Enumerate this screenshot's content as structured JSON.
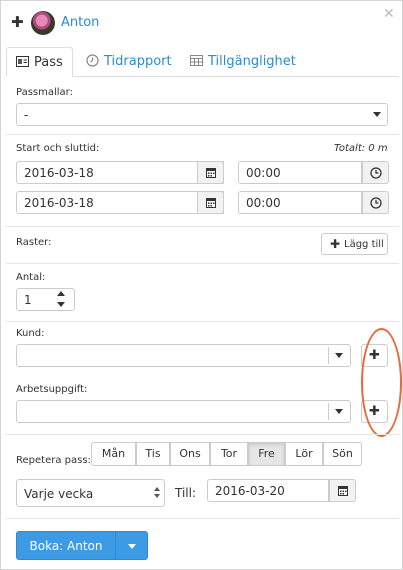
{
  "header": {
    "user_name": "Anton"
  },
  "tabs": [
    {
      "label": "Pass",
      "icon": "id-card-icon",
      "active": true
    },
    {
      "label": "Tidrapport",
      "icon": "clock-icon",
      "active": false
    },
    {
      "label": "Tillgänglighet",
      "icon": "calendar-icon",
      "active": false
    }
  ],
  "passmallar": {
    "label": "Passmallar:",
    "value": "-"
  },
  "time": {
    "label": "Start och sluttid:",
    "total": "Totalt: 0 m",
    "start_date": "2016-03-18",
    "start_time": "00:00",
    "end_date": "2016-03-18",
    "end_time": "00:00"
  },
  "raster": {
    "label": "Raster:",
    "add_label": "Lägg till"
  },
  "antal": {
    "label": "Antal:",
    "value": "1"
  },
  "kund": {
    "label": "Kund:",
    "value": ""
  },
  "arbetsuppgift": {
    "label": "Arbetsuppgift:",
    "value": ""
  },
  "repeat": {
    "label": "Repetera pass:",
    "days": [
      "Mån",
      "Tis",
      "Ons",
      "Tor",
      "Fre",
      "Lör",
      "Sön"
    ],
    "active_day": "Fre",
    "frequency": "Varje vecka",
    "till_label": "Till:",
    "till_date": "2016-03-20"
  },
  "actions": {
    "book_label": "Boka: Anton"
  },
  "colors": {
    "accent": "#3d9be6",
    "link": "#2a8bd8",
    "annotation": "#e86a3a"
  }
}
